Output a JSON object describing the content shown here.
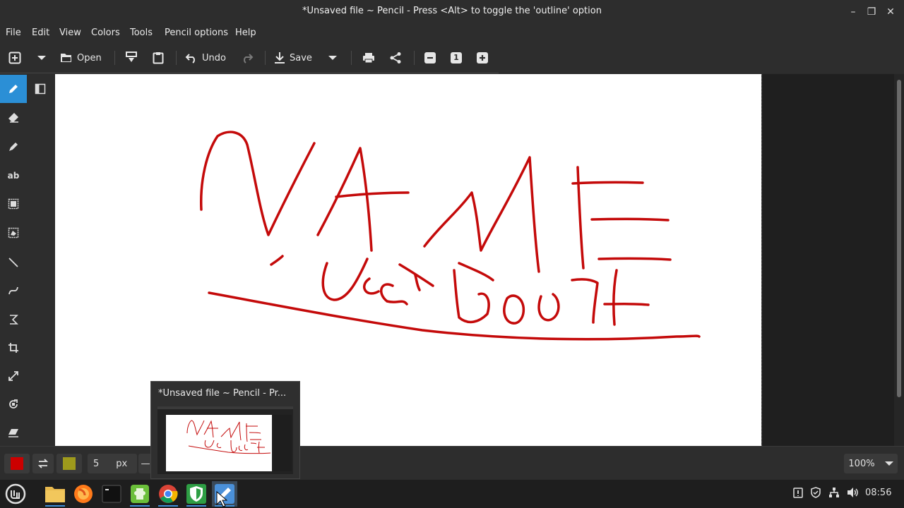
{
  "window": {
    "title": "*Unsaved file ~ Pencil - Press <Alt> to toggle the 'outline' option"
  },
  "menubar": {
    "items": [
      "File",
      "Edit",
      "View",
      "Colors",
      "Tools",
      "Pencil options",
      "Help"
    ]
  },
  "toolbar": {
    "open_label": "Open",
    "undo_label": "Undo",
    "save_label": "Save",
    "zoom_reset_label": "1"
  },
  "tools": [
    "pencil-icon",
    "panel-toggle-icon",
    "eraser-icon",
    "highlighter-icon",
    "text-icon",
    "rect-select-icon",
    "free-select-icon",
    "line-icon",
    "curve-icon",
    "shape-icon",
    "crop-icon",
    "scale-icon",
    "rotate-icon",
    "skew-icon"
  ],
  "drawing": {
    "stroke_color": "#c40a0a"
  },
  "bottombar": {
    "primary_color": "#cc0000",
    "secondary_color": "#9e9a1c",
    "size_value": "5",
    "size_unit": "px",
    "zoom_value": "100%"
  },
  "preview": {
    "title": "*Unsaved file ~ Pencil - Pr..."
  },
  "taskbar": {
    "clock": "08:56",
    "apps": [
      "mint-menu-icon",
      "files-icon",
      "firefox-icon",
      "terminal-icon",
      "puzzle-icon",
      "chrome-icon",
      "shield-app-icon",
      "pencil-app-icon"
    ]
  }
}
